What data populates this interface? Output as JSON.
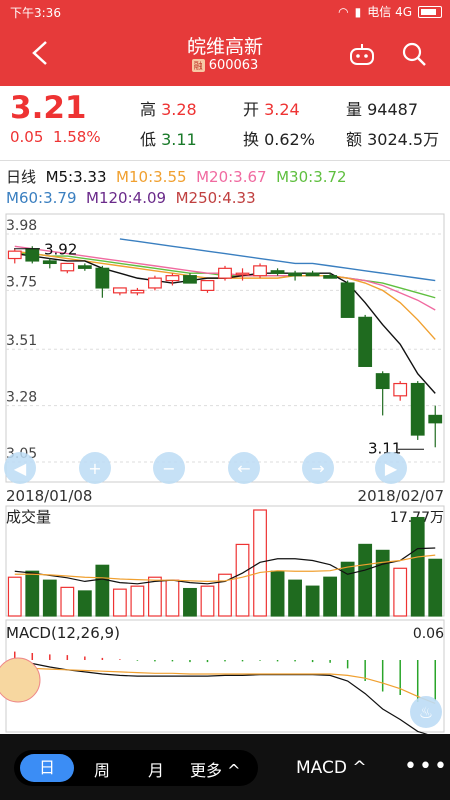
{
  "status": {
    "time": "下午3:36",
    "network": "电信 4G"
  },
  "header": {
    "title": "皖维高新",
    "margin_badge": "融",
    "code": "600063"
  },
  "quote": {
    "price": "3.21",
    "change": "0.05",
    "change_pct": "1.58%",
    "high_label": "高",
    "high": "3.28",
    "open_label": "开",
    "open": "3.24",
    "volume_label": "量",
    "volume": "94487",
    "low_label": "低",
    "low": "3.11",
    "turnover_label": "换",
    "turnover": "0.62%",
    "amount_label": "额",
    "amount": "3024.5万"
  },
  "ma": {
    "period": "日线",
    "m5": "M5:3.33",
    "m10": "M10:3.55",
    "m20": "M20:3.67",
    "m30": "M30:3.72",
    "m60": "M60:3.79",
    "m120": "M120:4.09",
    "m250": "M250:4.33"
  },
  "colors": {
    "up": "#e33",
    "down": "#1f6b1f",
    "m5": "#111111",
    "m10": "#f0a030",
    "m20": "#f06aa0",
    "m30": "#5fbf3f",
    "m60": "#3a7fc0",
    "m120": "#6a2a8a",
    "m250": "#c04040"
  },
  "kline": {
    "y_ticks": [
      "3.98",
      "3.75",
      "3.51",
      "3.28",
      "3.05"
    ],
    "start_date": "2018/01/08",
    "end_date": "2018/02/07",
    "max_label": "3.92",
    "min_label": "3.11",
    "candles": [
      {
        "o": 3.88,
        "h": 3.92,
        "l": 3.86,
        "c": 3.91
      },
      {
        "o": 3.92,
        "h": 3.93,
        "l": 3.86,
        "c": 3.87
      },
      {
        "o": 3.87,
        "h": 3.88,
        "l": 3.84,
        "c": 3.86
      },
      {
        "o": 3.83,
        "h": 3.86,
        "l": 3.82,
        "c": 3.86
      },
      {
        "o": 3.85,
        "h": 3.86,
        "l": 3.83,
        "c": 3.84
      },
      {
        "o": 3.84,
        "h": 3.85,
        "l": 3.72,
        "c": 3.76
      },
      {
        "o": 3.74,
        "h": 3.76,
        "l": 3.73,
        "c": 3.76
      },
      {
        "o": 3.74,
        "h": 3.76,
        "l": 3.73,
        "c": 3.75
      },
      {
        "o": 3.76,
        "h": 3.81,
        "l": 3.75,
        "c": 3.8
      },
      {
        "o": 3.79,
        "h": 3.82,
        "l": 3.77,
        "c": 3.81
      },
      {
        "o": 3.81,
        "h": 3.82,
        "l": 3.78,
        "c": 3.78
      },
      {
        "o": 3.75,
        "h": 3.79,
        "l": 3.74,
        "c": 3.79
      },
      {
        "o": 3.8,
        "h": 3.85,
        "l": 3.79,
        "c": 3.84
      },
      {
        "o": 3.82,
        "h": 3.84,
        "l": 3.79,
        "c": 3.82
      },
      {
        "o": 3.81,
        "h": 3.86,
        "l": 3.8,
        "c": 3.85
      },
      {
        "o": 3.83,
        "h": 3.84,
        "l": 3.81,
        "c": 3.82
      },
      {
        "o": 3.82,
        "h": 3.83,
        "l": 3.79,
        "c": 3.81
      },
      {
        "o": 3.82,
        "h": 3.83,
        "l": 3.81,
        "c": 3.81
      },
      {
        "o": 3.81,
        "h": 3.82,
        "l": 3.8,
        "c": 3.8
      },
      {
        "o": 3.78,
        "h": 3.79,
        "l": 3.64,
        "c": 3.64
      },
      {
        "o": 3.64,
        "h": 3.65,
        "l": 3.44,
        "c": 3.44
      },
      {
        "o": 3.41,
        "h": 3.42,
        "l": 3.24,
        "c": 3.35
      },
      {
        "o": 3.32,
        "h": 3.38,
        "l": 3.3,
        "c": 3.37
      },
      {
        "o": 3.37,
        "h": 3.38,
        "l": 3.14,
        "c": 3.16
      },
      {
        "o": 3.24,
        "h": 3.28,
        "l": 3.11,
        "c": 3.21
      }
    ],
    "ma5": [
      3.9,
      3.89,
      3.88,
      3.87,
      3.87,
      3.84,
      3.82,
      3.8,
      3.79,
      3.78,
      3.79,
      3.8,
      3.8,
      3.81,
      3.82,
      3.82,
      3.82,
      3.82,
      3.82,
      3.78,
      3.7,
      3.61,
      3.53,
      3.41,
      3.33
    ],
    "ma10": [
      3.91,
      3.9,
      3.89,
      3.88,
      3.87,
      3.86,
      3.85,
      3.84,
      3.83,
      3.82,
      3.81,
      3.8,
      3.8,
      3.8,
      3.8,
      3.8,
      3.81,
      3.81,
      3.81,
      3.8,
      3.78,
      3.75,
      3.7,
      3.63,
      3.55
    ],
    "ma20": [
      3.93,
      3.92,
      3.91,
      3.9,
      3.89,
      3.88,
      3.87,
      3.86,
      3.85,
      3.84,
      3.83,
      3.82,
      3.82,
      3.81,
      3.81,
      3.81,
      3.81,
      3.81,
      3.81,
      3.8,
      3.79,
      3.77,
      3.74,
      3.71,
      3.67
    ],
    "ma30": [
      3.9,
      3.9,
      3.89,
      3.89,
      3.88,
      3.87,
      3.86,
      3.85,
      3.84,
      3.83,
      3.82,
      3.82,
      3.81,
      3.81,
      3.81,
      3.81,
      3.81,
      3.81,
      3.81,
      3.8,
      3.79,
      3.78,
      3.76,
      3.74,
      3.72
    ],
    "ma60": [
      null,
      null,
      null,
      null,
      null,
      null,
      3.96,
      3.95,
      3.94,
      3.93,
      3.92,
      3.91,
      3.9,
      3.89,
      3.88,
      3.87,
      3.86,
      3.86,
      3.85,
      3.84,
      3.83,
      3.82,
      3.81,
      3.8,
      3.79
    ]
  },
  "volume": {
    "label": "成交量",
    "max_label": "17.77万",
    "values": [
      6.5,
      7.5,
      6.0,
      4.8,
      4.2,
      8.5,
      4.5,
      5.0,
      6.5,
      6.0,
      4.6,
      5.0,
      7.0,
      12.0,
      17.77,
      7.5,
      6.0,
      5.0,
      6.5,
      9.0,
      12.0,
      11.0,
      8.0,
      16.5,
      9.5
    ],
    "ma5": [
      7.5,
      7.2,
      6.8,
      6.4,
      5.8,
      6.2,
      5.6,
      5.4,
      5.8,
      6.0,
      5.6,
      5.4,
      5.8,
      7.2,
      9.0,
      9.6,
      9.6,
      9.3,
      8.6,
      7.0,
      7.7,
      8.7,
      9.3,
      11.3,
      11.4
    ],
    "ma10": [
      7.0,
      7.0,
      6.9,
      6.7,
      6.5,
      6.4,
      6.2,
      6.1,
      6.0,
      6.0,
      5.9,
      5.8,
      5.9,
      6.5,
      7.3,
      7.6,
      7.5,
      7.5,
      7.6,
      8.2,
      8.6,
      9.0,
      9.3,
      9.9,
      10.2
    ]
  },
  "macd": {
    "label": "MACD(12,26,9)",
    "max_label": "0.06",
    "hist": [
      0.012,
      0.01,
      0.008,
      0.007,
      0.005,
      0.003,
      0.001,
      -0.001,
      -0.002,
      -0.002,
      -0.003,
      -0.003,
      -0.002,
      -0.002,
      -0.001,
      -0.002,
      -0.002,
      -0.003,
      -0.004,
      -0.012,
      -0.03,
      -0.045,
      -0.05,
      -0.06,
      -0.058
    ],
    "dif": [
      0.0,
      -0.005,
      -0.01,
      -0.014,
      -0.017,
      -0.02,
      -0.022,
      -0.023,
      -0.023,
      -0.023,
      -0.023,
      -0.023,
      -0.022,
      -0.022,
      -0.021,
      -0.021,
      -0.021,
      -0.021,
      -0.022,
      -0.03,
      -0.048,
      -0.07,
      -0.085,
      -0.102,
      -0.11
    ],
    "dea": [
      -0.01,
      -0.012,
      -0.013,
      -0.014,
      -0.015,
      -0.016,
      -0.017,
      -0.018,
      -0.019,
      -0.019,
      -0.02,
      -0.02,
      -0.02,
      -0.02,
      -0.02,
      -0.02,
      -0.02,
      -0.02,
      -0.02,
      -0.022,
      -0.026,
      -0.033,
      -0.041,
      -0.052,
      -0.062
    ]
  },
  "controls": [
    "zoom-in",
    "zoom-out",
    "scroll-left",
    "scroll-right",
    "play"
  ],
  "bottom": {
    "tab_day": "日",
    "tab_week": "周",
    "tab_month": "月",
    "tab_more": "更多 ^",
    "indicator": "MACD ^",
    "more_dots": "•••"
  }
}
